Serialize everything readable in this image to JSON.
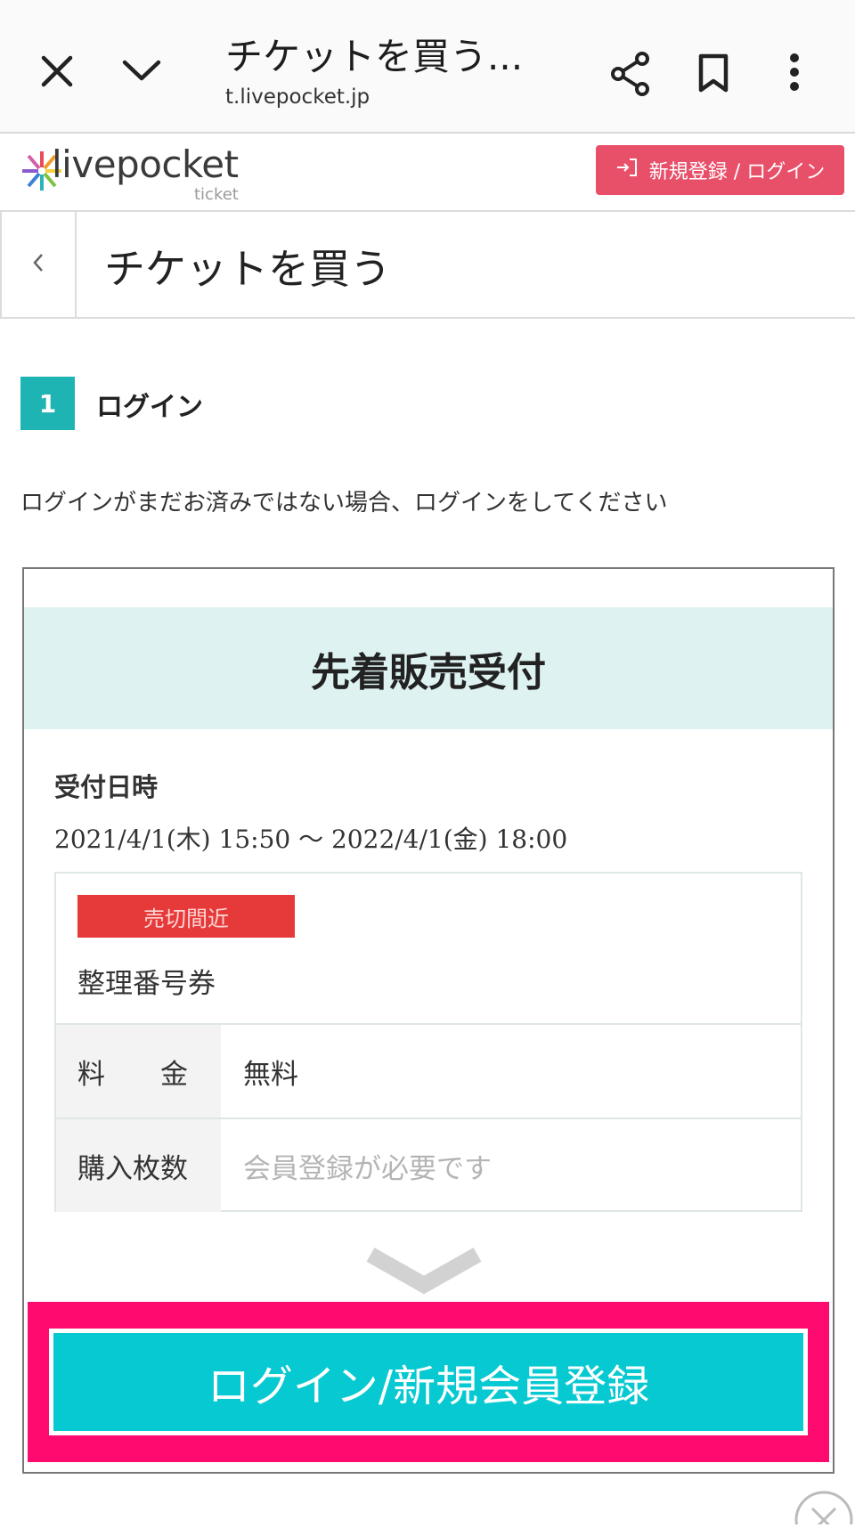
{
  "browser": {
    "page_title": "チケットを買う...",
    "url": "t.livepocket.jp"
  },
  "site": {
    "logo_text": "livepocket",
    "logo_sub": "ticket",
    "register_login_label": "新規登録 / ログイン"
  },
  "page": {
    "title": "チケットを買う"
  },
  "step": {
    "number": "1",
    "label": "ログイン",
    "instruction": "ログインがまだお済みではない場合、ログインをしてください"
  },
  "card": {
    "banner": "先着販売受付",
    "reception_heading": "受付日時",
    "reception_dates": "2021/4/1(木) 15:50 〜 2022/4/1(金) 18:00",
    "badge": "売切間近",
    "ticket_name": "整理番号券",
    "price_label": "料　　金",
    "price_value": "無料",
    "quantity_label": "購入枚数",
    "quantity_value": "会員登録が必要です",
    "cta_label": "ログイン/新規会員登録"
  },
  "colors": {
    "register_button": "#e8506a",
    "step_badge": "#1fb4b4",
    "banner_bg": "#ddf2f1",
    "soldout_badge": "#e63a3a",
    "cta_frame": "#ff0a6e",
    "cta_button": "#07c9d2"
  },
  "icons": [
    "close-icon",
    "chevron-down-icon",
    "share-icon",
    "bookmark-icon",
    "more-vert-icon",
    "login-icon",
    "back-chevron-icon",
    "close-circle-icon"
  ]
}
